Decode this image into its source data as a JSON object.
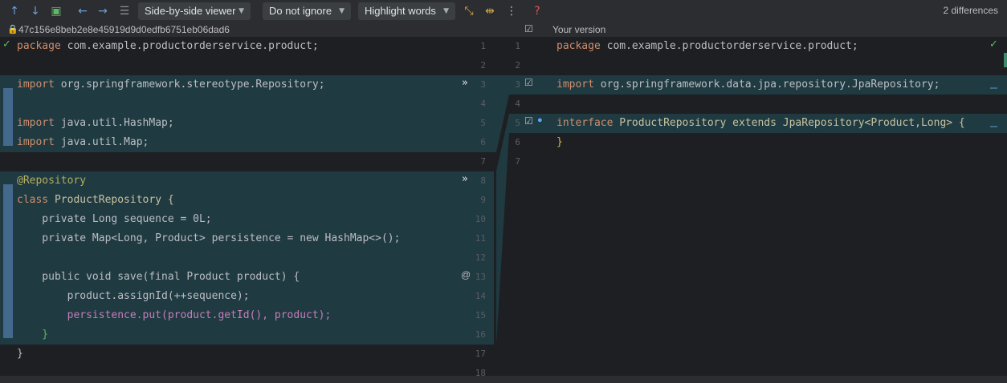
{
  "toolbar": {
    "icons": [
      "arrow-up-icon",
      "arrow-down-icon",
      "file-edit-icon",
      "arrow-left-icon",
      "arrow-right-icon",
      "list-icon",
      "collapse-icon",
      "sync-scroll-icon",
      "more-icon",
      "help-icon"
    ],
    "viewer": "Side-by-side viewer",
    "ignore": "Do not ignore",
    "highlight": "Highlight words",
    "differences": "2 differences"
  },
  "left": {
    "title": "47c156e8beb2e8e45919d9d0edfb6751eb06dad6",
    "lines": [
      "package com.example.productorderservice.product;",
      "",
      "import org.springframework.stereotype.Repository;",
      "",
      "import java.util.HashMap;",
      "import java.util.Map;",
      "",
      "@Repository",
      "class ProductRepository {",
      "    private Long sequence = 0L;",
      "    private Map<Long, Product> persistence = new HashMap<>();",
      "",
      "    public void save(final Product product) {",
      "        product.assignId(++sequence);",
      "        persistence.put(product.getId(), product);",
      "    }",
      "}",
      ""
    ],
    "numbers": [
      "1",
      "2",
      "3",
      "4",
      "5",
      "6",
      "7",
      "8",
      "9",
      "10",
      "11",
      "12",
      "13",
      "14",
      "15",
      "16",
      "17",
      "18"
    ]
  },
  "right": {
    "title": "Your version",
    "lines": [
      "package com.example.productorderservice.product;",
      "",
      "import org.springframework.data.jpa.repository.JpaRepository;",
      "",
      "interface ProductRepository extends JpaRepository<Product,Long> {",
      "}",
      ""
    ],
    "numbers": [
      "1",
      "2",
      "3",
      "4",
      "5",
      "6",
      "7"
    ]
  },
  "colors": {
    "editor_bg": "#1e1f22",
    "change_bg": "#1f3a41",
    "marker": "#43698d"
  }
}
